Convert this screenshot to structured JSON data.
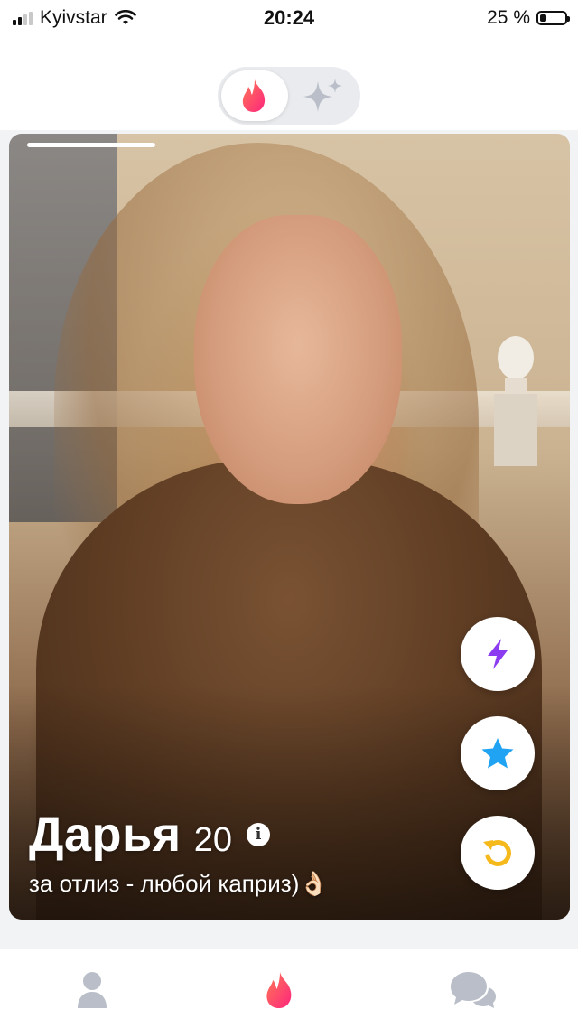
{
  "status_bar": {
    "carrier": "Kyivstar",
    "time": "20:24",
    "battery": "25 %",
    "battery_level": 0.25
  },
  "top_tabs": [
    {
      "icon": "flame-icon",
      "active": true
    },
    {
      "icon": "sparkle-icon",
      "active": false
    }
  ],
  "profile": {
    "name": "Дарья",
    "age": "20",
    "bio": "за отлиз - любой каприз)👌🏻",
    "info_icon": "i"
  },
  "actions": [
    {
      "icon": "boost-bolt-icon",
      "color": "#8c3cf0"
    },
    {
      "icon": "super-like-star-icon",
      "color": "#1fa3f2"
    },
    {
      "icon": "rewind-icon",
      "color": "#f5b91c"
    }
  ],
  "bottom_nav": [
    {
      "icon": "profile-icon",
      "active": false
    },
    {
      "icon": "flame-icon",
      "active": true
    },
    {
      "icon": "chat-icon",
      "active": false
    }
  ],
  "colors": {
    "brand": "#fd4f6a",
    "inactive_icon": "#b9bec8"
  }
}
